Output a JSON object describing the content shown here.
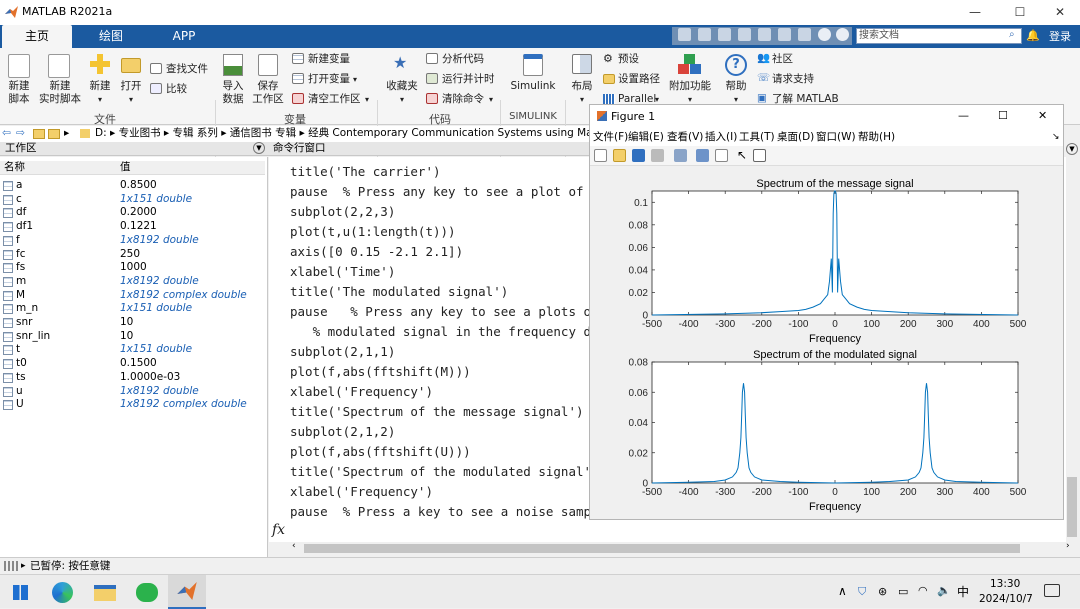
{
  "window": {
    "title": "MATLAB R2021a"
  },
  "tabs": [
    "主页",
    "绘图",
    "APP"
  ],
  "search": {
    "placeholder": "搜索文档"
  },
  "login_label": "登录",
  "ribbon": {
    "new_script": "新建\n脚本",
    "new_live_script": "新建\n实时脚本",
    "new": "新建",
    "open": "打开",
    "find_files": "查找文件",
    "compare": "比较",
    "file_section": "文件",
    "import_data": "导入\n数据",
    "save_workspace": "保存\n工作区",
    "new_variable": "新建变量",
    "open_variable": "打开变量",
    "clear_workspace": "清空工作区",
    "variable_section": "变量",
    "favorites": "收藏夹",
    "analyze_code": "分析代码",
    "run_and_time": "运行并计时",
    "clear_commands": "清除命令",
    "code_section": "代码",
    "simulink": "Simulink",
    "simulink_section": "SIMULINK",
    "layout": "布局",
    "preferences": "预设",
    "set_path": "设置路径",
    "parallel": "Parallel",
    "addons": "附加功能",
    "help": "帮助",
    "community": "社区",
    "request_support": "请求支持",
    "learn_matlab": "了解 MATLAB"
  },
  "address": {
    "path": "D: ▸ 专业图书 ▸ 专辑 系列 ▸ 通信图书 专辑 ▸ 经典 Contemporary Communication Systems using Matl"
  },
  "workspace": {
    "title": "工作区",
    "col_name": "名称",
    "col_value": "值",
    "variables": [
      {
        "name": "a",
        "value": "0.8500"
      },
      {
        "name": "c",
        "value": "1x151 double"
      },
      {
        "name": "df",
        "value": "0.2000"
      },
      {
        "name": "df1",
        "value": "0.1221"
      },
      {
        "name": "f",
        "value": "1x8192 double"
      },
      {
        "name": "fc",
        "value": "250"
      },
      {
        "name": "fs",
        "value": "1000"
      },
      {
        "name": "m",
        "value": "1x8192 double"
      },
      {
        "name": "M",
        "value": "1x8192 complex double"
      },
      {
        "name": "m_n",
        "value": "1x151 double"
      },
      {
        "name": "snr",
        "value": "10"
      },
      {
        "name": "snr_lin",
        "value": "10"
      },
      {
        "name": "t",
        "value": "1x151 double"
      },
      {
        "name": "t0",
        "value": "0.1500"
      },
      {
        "name": "ts",
        "value": "1.0000e-03"
      },
      {
        "name": "u",
        "value": "1x8192 double"
      },
      {
        "name": "U",
        "value": "1x8192 complex double"
      }
    ]
  },
  "command_window": {
    "title": "命令行窗口",
    "prompt": "fx",
    "lines": [
      "title('The carrier')",
      "pause  % Press any key to see a plot of the m",
      "subplot(2,2,3)",
      "plot(t,u(1:length(t)))",
      "axis([0 0.15 -2.1 2.1])",
      "xlabel('Time')",
      "title('The modulated signal')",
      "pause   % Press any key to see a plots of the",
      "   % modulated signal in the frequency domai",
      "subplot(2,1,1)",
      "plot(f,abs(fftshift(M)))",
      "xlabel('Frequency')",
      "title('Spectrum of the message signal')",
      "subplot(2,1,2)",
      "plot(f,abs(fftshift(U)))",
      "title('Spectrum of the modulated signal')",
      "xlabel('Frequency')",
      "pause  % Press a key to see a noise sample"
    ]
  },
  "figure": {
    "title": "Figure 1",
    "menu": [
      "文件(F)",
      "编辑(E)",
      "查看(V)",
      "插入(I)",
      "工具(T)",
      "桌面(D)",
      "窗口(W)",
      "帮助(H)"
    ]
  },
  "status": {
    "text": "已暂停: 按任意键"
  },
  "taskbar": {
    "time": "13:30",
    "date": "2024/10/7",
    "ime": "中"
  },
  "chart_data": [
    {
      "type": "line",
      "title": "Spectrum of the message signal",
      "xlabel": "Frequency",
      "ylabel": "",
      "xlim": [
        -500,
        500
      ],
      "ylim": [
        0,
        0.11
      ],
      "xticks": [
        -500,
        -400,
        -300,
        -200,
        -100,
        0,
        100,
        200,
        300,
        400,
        500
      ],
      "yticks": [
        0,
        0.02,
        0.04,
        0.06,
        0.08,
        0.1
      ],
      "grid": false,
      "series": [
        {
          "x": [
            -500,
            -300,
            -200,
            -150,
            -100,
            -80,
            -60,
            -40,
            -30,
            -20,
            -15,
            -10,
            -7,
            -5,
            -3,
            -1,
            0,
            1,
            3,
            5,
            7,
            10,
            15,
            20,
            30,
            40,
            60,
            80,
            100,
            150,
            200,
            300,
            500
          ],
          "y": [
            0,
            0.001,
            0.002,
            0.003,
            0.004,
            0.005,
            0.007,
            0.01,
            0.014,
            0.018,
            0.03,
            0.05,
            0.02,
            0.09,
            0.108,
            0.11,
            0.11,
            0.11,
            0.108,
            0.09,
            0.02,
            0.05,
            0.03,
            0.018,
            0.014,
            0.01,
            0.007,
            0.005,
            0.004,
            0.003,
            0.002,
            0.001,
            0
          ]
        }
      ]
    },
    {
      "type": "line",
      "title": "Spectrum of the modulated signal",
      "xlabel": "Frequency",
      "ylabel": "",
      "xlim": [
        -500,
        500
      ],
      "ylim": [
        0,
        0.08
      ],
      "xticks": [
        -500,
        -400,
        -300,
        -200,
        -100,
        0,
        100,
        200,
        300,
        400,
        500
      ],
      "yticks": [
        0,
        0.02,
        0.04,
        0.06,
        0.08
      ],
      "grid": false,
      "series": [
        {
          "x": [
            -500,
            -400,
            -330,
            -300,
            -280,
            -270,
            -265,
            -260,
            -257,
            -255,
            -253,
            -250,
            -247,
            -245,
            -243,
            -240,
            -235,
            -230,
            -220,
            -200,
            -150,
            -100,
            0,
            100,
            150,
            200,
            220,
            230,
            235,
            240,
            243,
            245,
            247,
            250,
            253,
            255,
            257,
            260,
            265,
            270,
            280,
            300,
            330,
            400,
            500
          ],
          "y": [
            0,
            0.0005,
            0.001,
            0.002,
            0.004,
            0.007,
            0.01,
            0.02,
            0.03,
            0.045,
            0.06,
            0.066,
            0.06,
            0.045,
            0.03,
            0.02,
            0.01,
            0.007,
            0.004,
            0.002,
            0.001,
            0.0005,
            0,
            0.0005,
            0.001,
            0.002,
            0.004,
            0.007,
            0.01,
            0.02,
            0.03,
            0.045,
            0.06,
            0.066,
            0.06,
            0.045,
            0.03,
            0.02,
            0.01,
            0.007,
            0.004,
            0.002,
            0.001,
            0.0005,
            0
          ]
        }
      ]
    }
  ]
}
